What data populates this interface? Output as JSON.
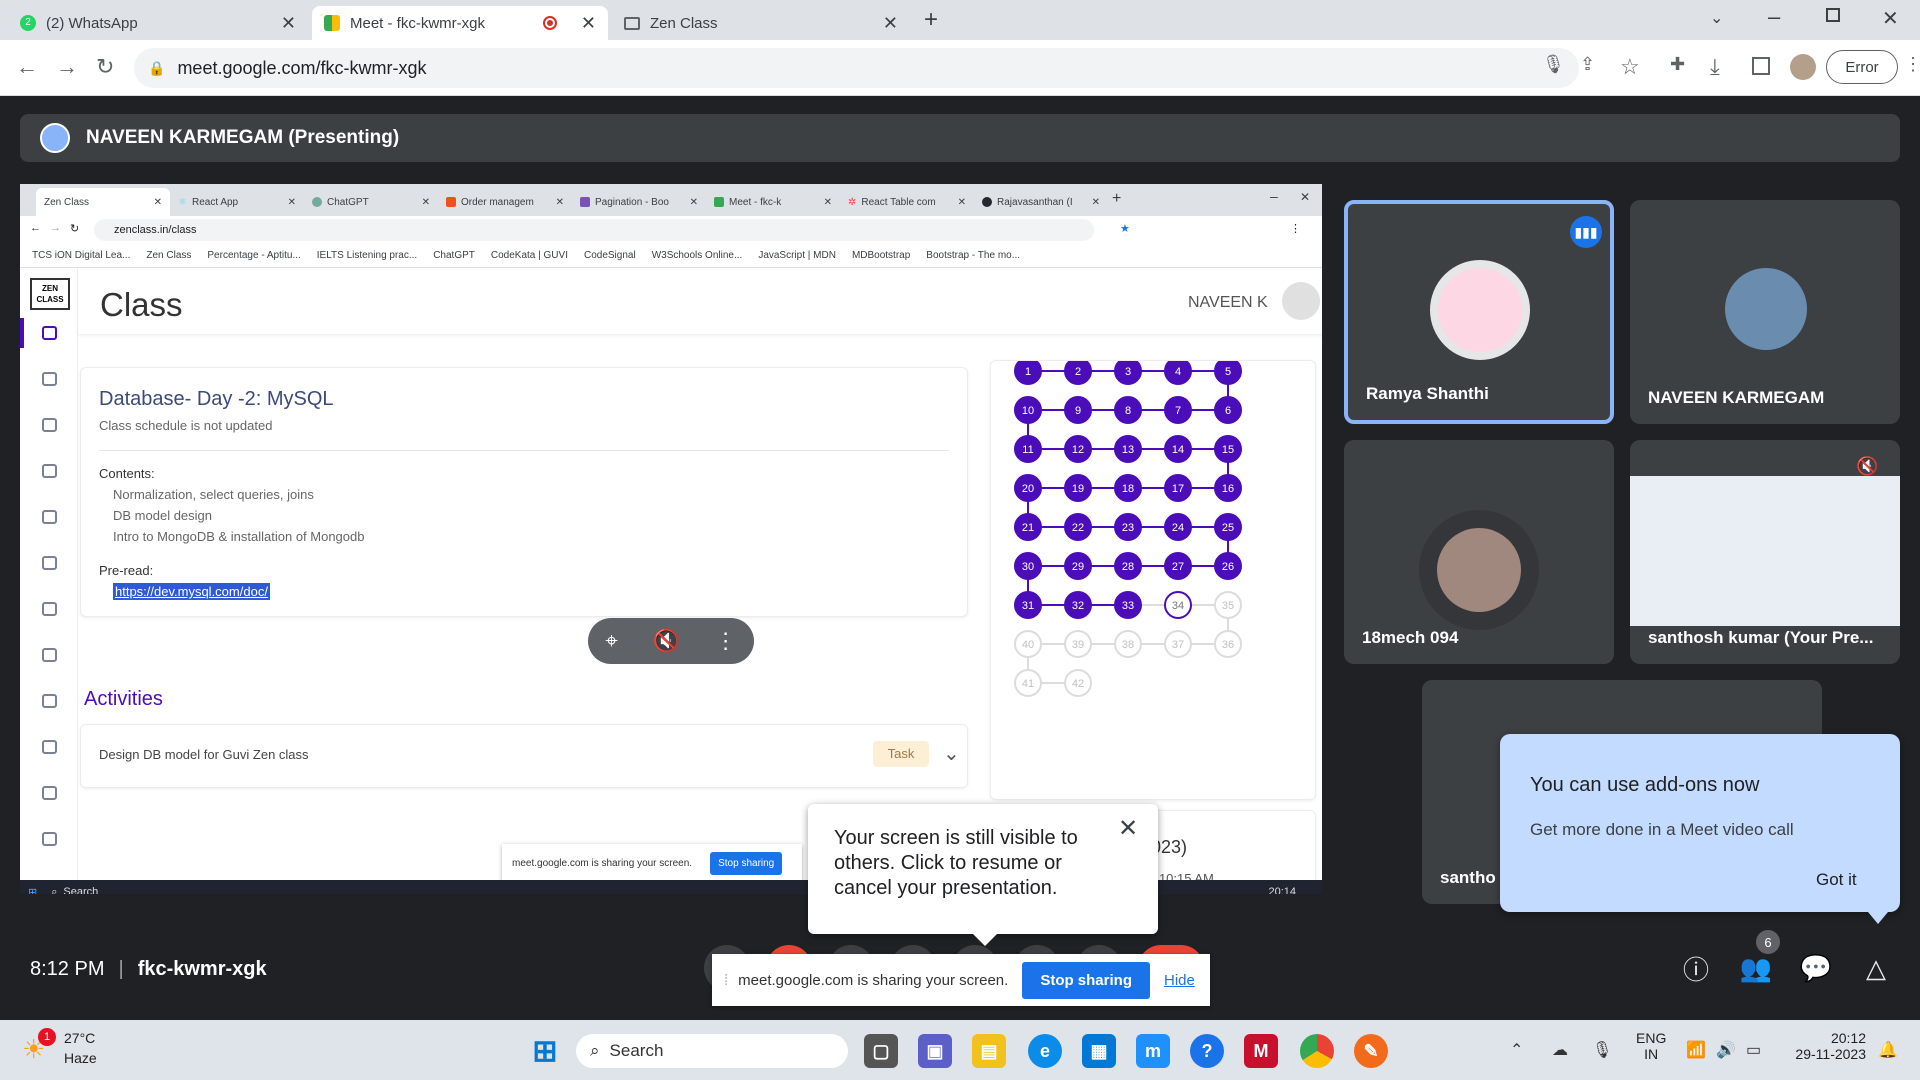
{
  "browser": {
    "tabs": [
      {
        "title": "(2) WhatsApp",
        "icon": "whatsapp-icon"
      },
      {
        "title": "Meet - fkc-kwmr-xgk",
        "icon": "meet-icon"
      },
      {
        "title": "Zen Class",
        "icon": "zen-icon"
      }
    ],
    "url": "meet.google.com/fkc-kwmr-xgk",
    "error_label": "Error"
  },
  "presenter_bar": {
    "label": "NAVEEN KARMEGAM (Presenting)"
  },
  "inner_browser": {
    "tabs": [
      "Zen Class",
      "React App",
      "ChatGPT",
      "Order managem",
      "Pagination - Boo",
      "Meet - fkc-k",
      "React Table com",
      "Rajavasanthan (I"
    ],
    "url": "zenclass.in/class",
    "bookmarks": [
      "TCS iON Digital Lea...",
      "Zen Class",
      "Percentage - Aptitu...",
      "IELTS Listening prac...",
      "ChatGPT",
      "CodeKata | GUVI",
      "CodeSignal",
      "W3Schools Online...",
      "JavaScript | MDN",
      "MDBootstrap",
      "Bootstrap - The mo..."
    ]
  },
  "zen": {
    "logo": "ZEN CLASS",
    "page_title": "Class",
    "user_name": "NAVEEN K",
    "session": {
      "title": "Database- Day -2: MySQL",
      "schedule": "Class schedule is not updated",
      "contents_label": "Contents:",
      "contents": [
        "Normalization, select queries, joins",
        "DB model design",
        "Intro to MongoDB & installation of Mongodb"
      ],
      "preread_label": "Pre-read:",
      "preread_link": "https://dev.mysql.com/doc/"
    },
    "activities_label": "Activities",
    "activity": {
      "title": "Design DB model for Guvi Zen class",
      "badge": "Task"
    },
    "days": {
      "completed": 33,
      "current": 34,
      "total": 42
    },
    "bg_card_fragments": {
      "a": "023)",
      "b": "- 10:15 AM"
    }
  },
  "inner_share_bar": {
    "text": "meet.google.com is sharing your screen.",
    "button": "Stop sharing"
  },
  "inner_taskbar": {
    "search": "Search",
    "time": "20:14"
  },
  "popover": {
    "text": "Your screen is still visible to others. Click to resume or cancel your presentation."
  },
  "participants": [
    {
      "name": "Ramya Shanthi"
    },
    {
      "name": "NAVEEN KARMEGAM"
    },
    {
      "name": "18mech 094"
    },
    {
      "name": "santhosh kumar (Your Pre..."
    },
    {
      "name": "santho"
    }
  ],
  "addons_popup": {
    "title": "You can use add-ons now",
    "body": "Get more done in a Meet video call",
    "button": "Got it"
  },
  "meeting_info": {
    "time": "8:12 PM",
    "code": "fkc-kwmr-xgk",
    "people_count": "6"
  },
  "share_bar": {
    "text": "meet.google.com is sharing your screen.",
    "stop": "Stop sharing",
    "hide": "Hide"
  },
  "os_taskbar": {
    "weather_temp": "27°C",
    "weather_desc": "Haze",
    "weather_badge": "1",
    "search": "Search",
    "lang": "ENG",
    "region": "IN",
    "time": "20:12",
    "date": "29-11-2023"
  }
}
